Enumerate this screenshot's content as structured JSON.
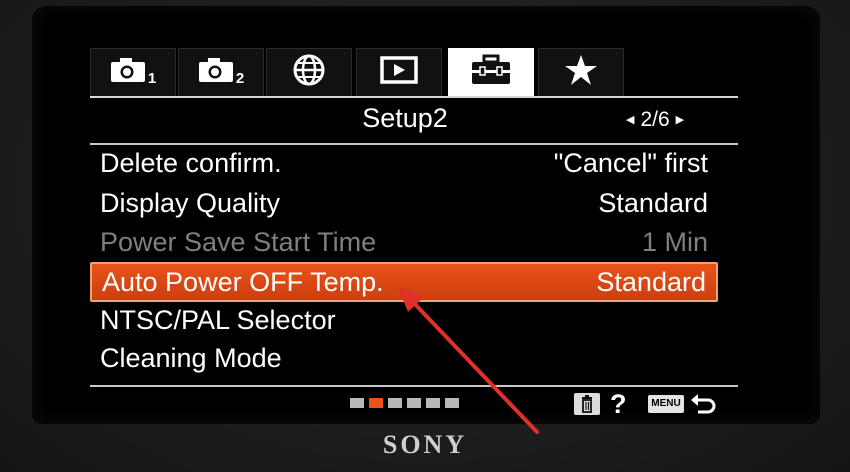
{
  "tabs": [
    {
      "icon": "camera-icon",
      "number": "1"
    },
    {
      "icon": "camera-icon",
      "number": "2"
    },
    {
      "icon": "globe-icon",
      "number": ""
    },
    {
      "icon": "playback-icon",
      "number": ""
    },
    {
      "icon": "toolbox-icon",
      "number": "",
      "selected": true
    },
    {
      "icon": "star-icon",
      "number": ""
    }
  ],
  "header": {
    "title": "Setup2",
    "page": "2/6"
  },
  "menu_items": [
    {
      "label": "Delete confirm.",
      "value": "\"Cancel\" first",
      "state": "normal"
    },
    {
      "label": "Display Quality",
      "value": "Standard",
      "state": "normal"
    },
    {
      "label": "Power Save Start Time",
      "value": "1 Min",
      "state": "disabled"
    },
    {
      "label": "Auto Power OFF Temp.",
      "value": "Standard",
      "state": "selected"
    },
    {
      "label": "NTSC/PAL Selector",
      "value": "",
      "state": "normal"
    },
    {
      "label": "Cleaning Mode",
      "value": "",
      "state": "normal"
    }
  ],
  "footer": {
    "page_dots_total": 6,
    "page_dot_active": 2,
    "help": "?",
    "menu_label": "MENU"
  },
  "brand": "SONY",
  "colors": {
    "accent": "#e8531a",
    "annotation_arrow": "#e0302a"
  }
}
